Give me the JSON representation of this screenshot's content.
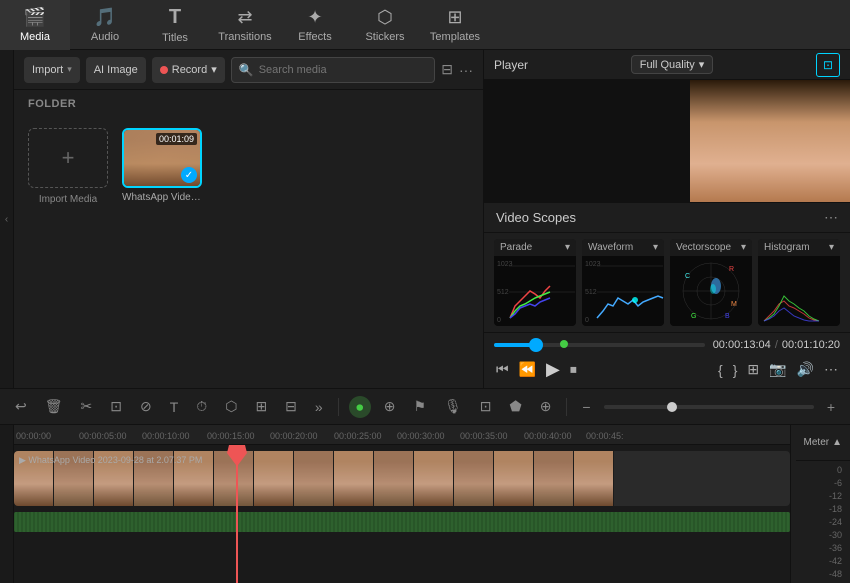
{
  "nav": {
    "items": [
      {
        "id": "media",
        "label": "Media",
        "icon": "🎬",
        "active": true
      },
      {
        "id": "audio",
        "label": "Audio",
        "icon": "🎵"
      },
      {
        "id": "titles",
        "label": "Titles",
        "icon": "T"
      },
      {
        "id": "transitions",
        "label": "Transitions",
        "icon": "↔"
      },
      {
        "id": "effects",
        "label": "Effects",
        "icon": "✦"
      },
      {
        "id": "stickers",
        "label": "Stickers",
        "icon": "⬡"
      },
      {
        "id": "templates",
        "label": "Templates",
        "icon": "⊞"
      }
    ]
  },
  "left_panel": {
    "import_label": "Import",
    "ai_image_label": "AI Image",
    "record_label": "Record",
    "search_placeholder": "Search media",
    "folder_label": "FOLDER",
    "import_media_label": "Import Media",
    "media_items": [
      {
        "name": "WhatsApp Video 202...",
        "duration": "00:01:09"
      }
    ]
  },
  "player": {
    "title": "Player",
    "quality": "Full Quality",
    "current_time": "00:00:13:04",
    "total_time": "00:01:10:20"
  },
  "video_scopes": {
    "title": "Video Scopes",
    "scopes": [
      {
        "id": "parade",
        "label": "Parade"
      },
      {
        "id": "waveform",
        "label": "Waveform"
      },
      {
        "id": "vectorscope",
        "label": "Vectorscope"
      },
      {
        "id": "histogram",
        "label": "Histogram"
      }
    ]
  },
  "timeline": {
    "meter_label": "Meter",
    "track_name": "WhatsApp Video 2023-09-28 at 2.07.37 PM",
    "meter_values": [
      "0",
      "-6",
      "-12",
      "-18",
      "-24",
      "-30",
      "-36",
      "-42",
      "-48"
    ],
    "ruler_marks": [
      "00:00:00",
      "00:00:05:00",
      "00:00:10:00",
      "00:00:15:00",
      "00:00:20:00",
      "00:00:25:00",
      "00:00:30:00",
      "00:00:35:00",
      "00:00:40:00",
      "00:00:45:"
    ]
  },
  "toolbar": {
    "undo_label": "↩",
    "delete_label": "🗑",
    "cut_label": "✂",
    "crop_label": "⊡",
    "split_label": "⊘"
  }
}
